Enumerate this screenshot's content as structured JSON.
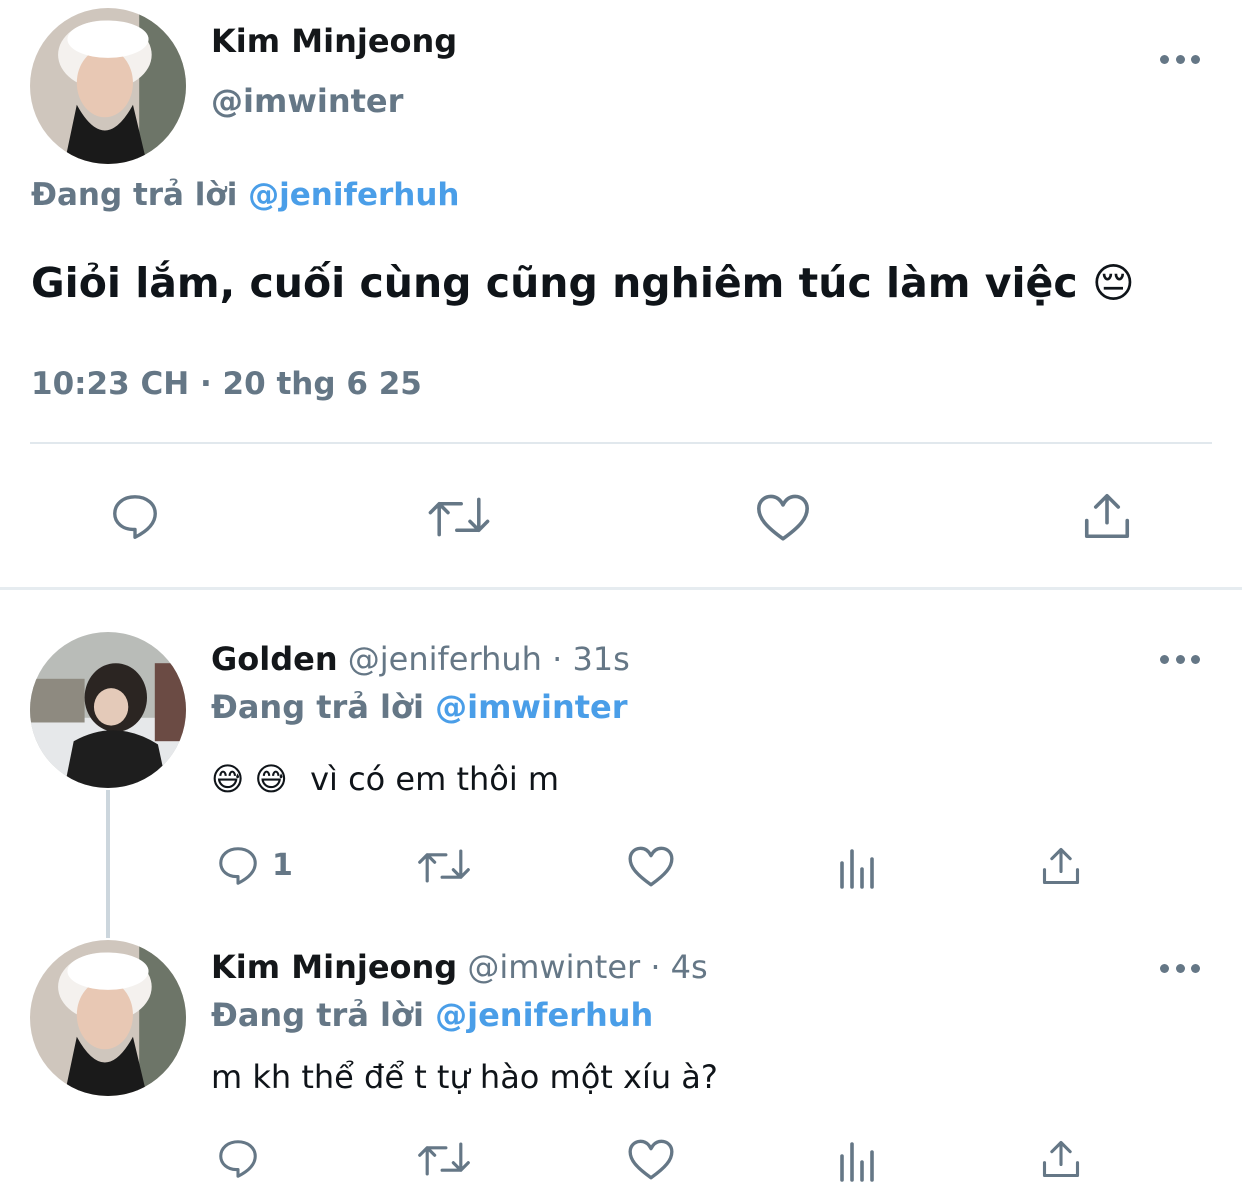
{
  "main_tweet": {
    "name": "Kim Minjeong",
    "handle": "@imwinter",
    "replying_prefix": "Đang trả lời",
    "replying_to": "@jeniferhuh",
    "text": "Giỏi lắm, cuối cùng cũng nghiêm túc làm việc",
    "emoji": "😔",
    "timestamp": "10:23 CH · 20 thg 6 25"
  },
  "replies": [
    {
      "name": "Golden",
      "handle": "@jeniferhuh",
      "time": "· 31s",
      "replying_prefix": "Đang trả lời",
      "replying_to": "@imwinter",
      "emoji": "😅 😅",
      "text": "vì có em thôi m",
      "reply_count": "1"
    },
    {
      "name": "Kim Minjeong",
      "handle": "@imwinter",
      "time": "· 4s",
      "replying_prefix": "Đang trả lời",
      "replying_to": "@jeniferhuh",
      "text": "m kh thể để t tự hào một xíu à?"
    }
  ],
  "icons": {
    "reply": "reply-icon",
    "retweet": "retweet-icon",
    "like": "heart-icon",
    "share": "share-icon",
    "views": "views-icon",
    "more": "more-icon"
  },
  "colors": {
    "link": "#4a9ee8",
    "secondary": "#657786",
    "divider": "#e1e8ed"
  }
}
